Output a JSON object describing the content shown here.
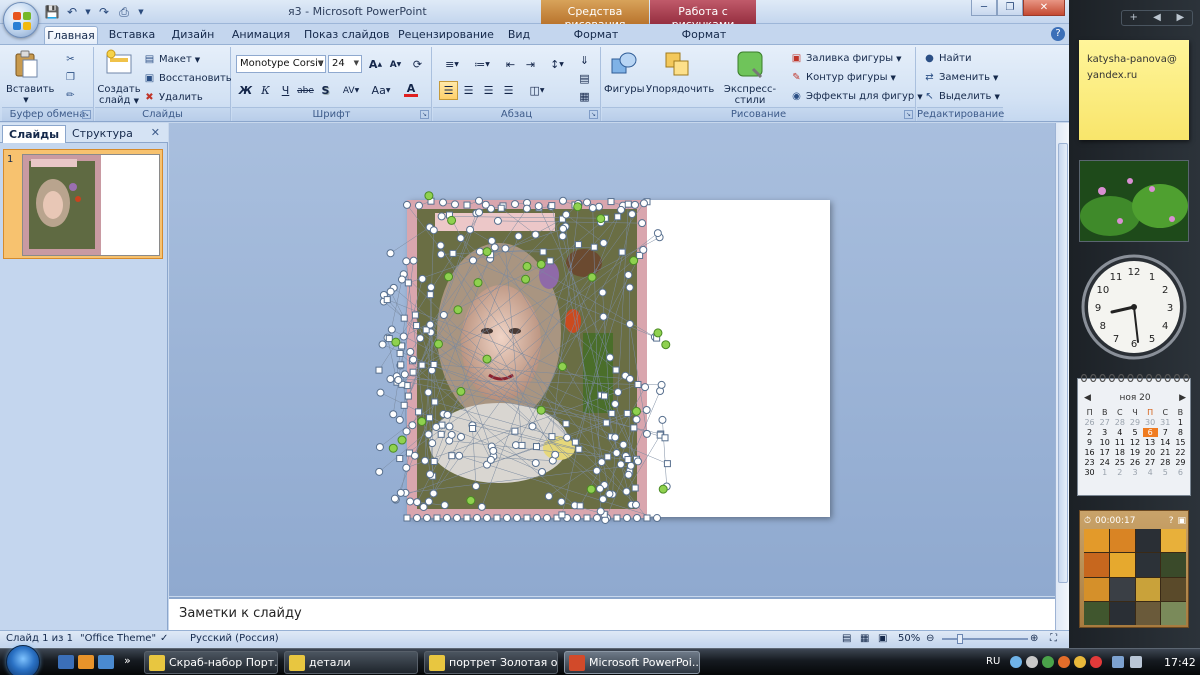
{
  "window": {
    "title": "я3 - Microsoft PowerPoint",
    "context_tab_drawing": "Средства рисования",
    "context_tab_picture": "Работа с рисунками"
  },
  "ribbon_tabs": [
    "Главная",
    "Вставка",
    "Дизайн",
    "Анимация",
    "Показ слайдов",
    "Рецензирование",
    "Вид",
    "Формат",
    "Формат"
  ],
  "groups": {
    "clipboard": {
      "label": "Буфер обмена",
      "paste": "Вставить"
    },
    "slides": {
      "label": "Слайды",
      "new_slide_line1": "Создать",
      "new_slide_line2": "слайд",
      "layout": "Макет",
      "reset": "Восстановить",
      "delete": "Удалить"
    },
    "font": {
      "label": "Шрифт",
      "font_name": "Monotype Corsiv",
      "font_size": "24",
      "bold": "Ж",
      "italic": "К",
      "underline": "Ч",
      "strike": "abe",
      "shadow": "S",
      "spacing": "AV",
      "case": "Aa",
      "color": "A"
    },
    "paragraph": {
      "label": "Абзац"
    },
    "drawing": {
      "label": "Рисование",
      "shapes": "Фигуры",
      "arrange": "Упорядочить",
      "quick_styles": "Экспресс-стили",
      "shape_fill": "Заливка фигуры",
      "shape_outline": "Контур фигуры",
      "shape_effects": "Эффекты для фигур"
    },
    "editing": {
      "label": "Редактирование",
      "find": "Найти",
      "replace": "Заменить",
      "select": "Выделить"
    }
  },
  "left_panel": {
    "tab_slides": "Слайды",
    "tab_outline": "Структура",
    "slide_number": "1"
  },
  "notes_placeholder": "Заметки к слайду",
  "status_bar": {
    "slide_info": "Слайд 1 из 1",
    "theme": "\"Office Theme\"",
    "language": "Русский (Россия)",
    "zoom": "50%"
  },
  "sidebar": {
    "sticky_note": "katysha-panova@yandex.ru",
    "calendar": {
      "month": "ноя 20",
      "days_of_week": [
        "П",
        "В",
        "С",
        "Ч",
        "П",
        "С",
        "В"
      ],
      "weeks": [
        [
          "26",
          "27",
          "28",
          "29",
          "30",
          "31",
          "1"
        ],
        [
          "2",
          "3",
          "4",
          "5",
          "6",
          "7",
          "8"
        ],
        [
          "9",
          "10",
          "11",
          "12",
          "13",
          "14",
          "15"
        ],
        [
          "16",
          "17",
          "18",
          "19",
          "20",
          "21",
          "22"
        ],
        [
          "23",
          "24",
          "25",
          "26",
          "27",
          "28",
          "29"
        ],
        [
          "30",
          "1",
          "2",
          "3",
          "4",
          "5",
          "6"
        ]
      ],
      "today": "6"
    },
    "puzzle_timer": "00:00:17",
    "clock_time": "9:27"
  },
  "taskbar": {
    "tasks": [
      "Скраб-набор Порт...",
      "детали",
      "портрет Золотая о...",
      "Microsoft PowerPoi..."
    ],
    "language": "RU",
    "time": "17:42"
  },
  "colors": {
    "ribbon_accent": "#c4d6ee",
    "drawing_tab": "#c9893f",
    "picture_tab": "#a63a4b",
    "calendar_today": "#ef7b20"
  }
}
